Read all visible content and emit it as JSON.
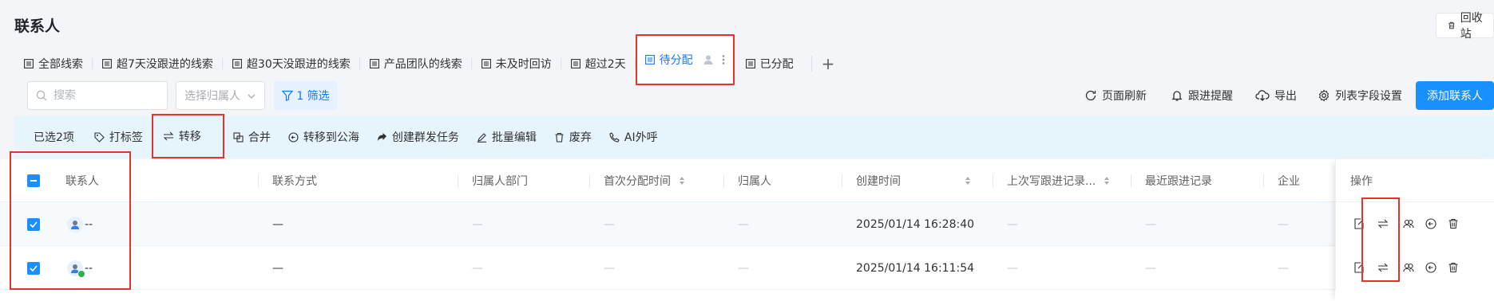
{
  "page": {
    "title": "联系人",
    "recycle_label": "回收站"
  },
  "tabs": [
    {
      "label": "全部线索"
    },
    {
      "label": "超7天没跟进的线索"
    },
    {
      "label": "超30天没跟进的线索"
    },
    {
      "label": "产品团队的线索"
    },
    {
      "label": "未及时回访"
    },
    {
      "label": "超过2天"
    },
    {
      "label": "待分配",
      "active": true
    },
    {
      "label": "已分配"
    }
  ],
  "tab_add": "+",
  "toolbar": {
    "search_placeholder": "搜索",
    "owner_placeholder": "选择归属人",
    "filter_label": "1 筛选",
    "refresh_label": "页面刷新",
    "remind_label": "跟进提醒",
    "export_label": "导出",
    "columns_label": "列表字段设置",
    "add_label": "添加联系人"
  },
  "batch": {
    "selected_label": "已选2项",
    "actions": [
      "打标签",
      "转移",
      "合并",
      "转移到公海",
      "创建群发任务",
      "批量编辑",
      "废弃",
      "AI外呼"
    ]
  },
  "table": {
    "columns": [
      "联系人",
      "联系方式",
      "归属人部门",
      "首次分配时间",
      "归属人",
      "创建时间",
      "上次写跟进记录...",
      "最近跟进记录",
      "企业",
      "操作"
    ],
    "rows": [
      {
        "contact": "--",
        "method": "—",
        "dept": "—",
        "first_assign": "—",
        "owner": "—",
        "created": "2025/01/14 16:28:40",
        "last_follow_write": "—",
        "recent_follow": "—",
        "company": "—",
        "checked": true,
        "wechat": false
      },
      {
        "contact": "--",
        "method": "—",
        "dept": "—",
        "first_assign": "—",
        "owner": "—",
        "created": "2025/01/14 16:11:54",
        "last_follow_write": "—",
        "recent_follow": "—",
        "company": "—",
        "checked": true,
        "wechat": true
      }
    ]
  },
  "colors": {
    "accent": "#1890ff",
    "highlight_border": "#e5322d",
    "batch_bg": "#e6f4fb"
  }
}
